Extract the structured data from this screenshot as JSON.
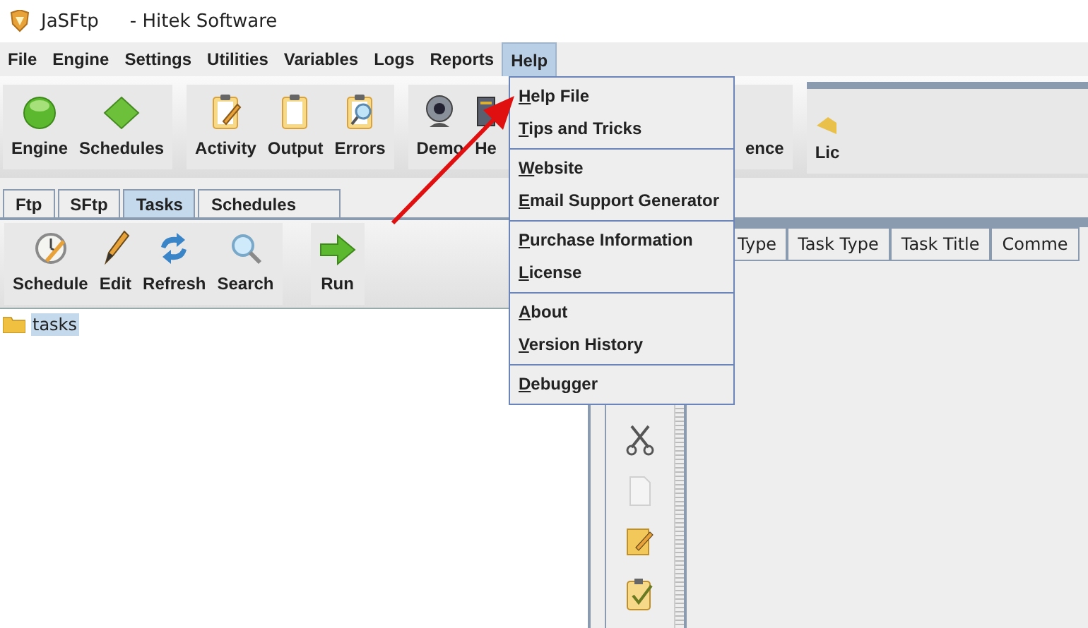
{
  "window": {
    "app_name": "JaSFtp",
    "subtitle": "- Hitek Software"
  },
  "menu_bar": [
    {
      "label": "File",
      "selected": false
    },
    {
      "label": "Engine",
      "selected": false
    },
    {
      "label": "Settings",
      "selected": false
    },
    {
      "label": "Utilities",
      "selected": false
    },
    {
      "label": "Variables",
      "selected": false
    },
    {
      "label": "Logs",
      "selected": false
    },
    {
      "label": "Reports",
      "selected": false
    },
    {
      "label": "Help",
      "selected": true
    }
  ],
  "toolbar": {
    "groups": [
      {
        "items": [
          "Engine",
          "Schedules"
        ]
      },
      {
        "items": [
          "Activity",
          "Output",
          "Errors"
        ]
      },
      {
        "items": [
          "Demo",
          "He",
          "ence"
        ]
      }
    ],
    "right_item": "Lic"
  },
  "help_menu": [
    {
      "items": [
        "Help File",
        "Tips and Tricks"
      ]
    },
    {
      "items": [
        "Website",
        "Email Support Generator"
      ]
    },
    {
      "items": [
        "Purchase Information",
        "License"
      ]
    },
    {
      "items": [
        "About",
        "Version History"
      ]
    },
    {
      "items": [
        "Debugger"
      ]
    }
  ],
  "tabs": [
    {
      "label": "Ftp",
      "selected": false
    },
    {
      "label": "SFtp",
      "selected": false
    },
    {
      "label": "Tasks",
      "selected": true
    },
    {
      "label": "Schedules",
      "selected": false
    }
  ],
  "task_toolbar": {
    "groups": [
      {
        "items": [
          "Schedule",
          "Edit",
          "Refresh",
          "Search"
        ]
      },
      {
        "items": [
          "Run"
        ]
      }
    ]
  },
  "tree": [
    {
      "label": "tasks",
      "selected": true
    }
  ],
  "table": {
    "columns": [
      "Type",
      "Task Type",
      "Task Title",
      "Comme"
    ]
  }
}
